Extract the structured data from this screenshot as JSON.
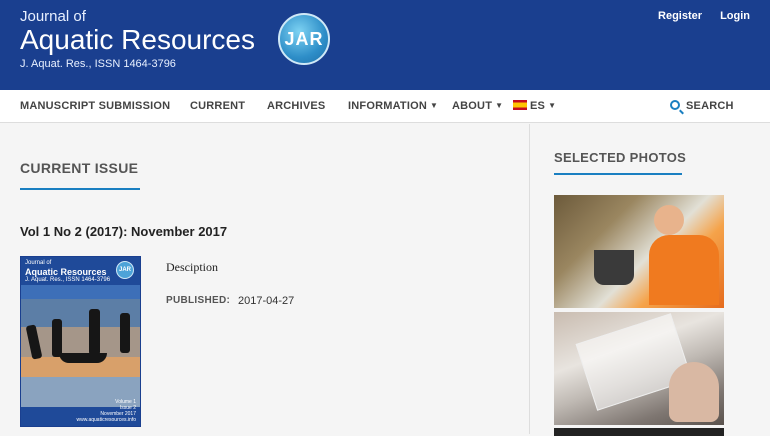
{
  "header": {
    "brand_top": "Journal of",
    "brand_main": "Aquatic Resources",
    "brand_sub": "J. Aquat. Res., ISSN 1464-3796",
    "logo_text": "JAR",
    "register": "Register",
    "login": "Login"
  },
  "nav": {
    "items": [
      "MANUSCRIPT SUBMISSION",
      "CURRENT",
      "ARCHIVES",
      "INFORMATION",
      "ABOUT"
    ],
    "language": "ES",
    "search": "SEARCH"
  },
  "main": {
    "section_title": "CURRENT ISSUE",
    "issue_title": "Vol 1 No 2 (2017): November 2017",
    "description": "Desciption",
    "published_label": "PUBLISHED:",
    "published_date": "2017-04-27"
  },
  "cover": {
    "top": "Journal of",
    "title": "Aquatic Resources",
    "sub": "J. Aquat. Res., ISSN 1464-3796",
    "logo": "JAR",
    "volume": "Volume 1",
    "issue": "Issue 2",
    "date": "November 2017",
    "site": "www.aquaticresources.info"
  },
  "sidebar": {
    "title": "SELECTED PHOTOS"
  },
  "colors": {
    "header_bg": "#1a3f8f",
    "accent": "#1a7fc1"
  }
}
